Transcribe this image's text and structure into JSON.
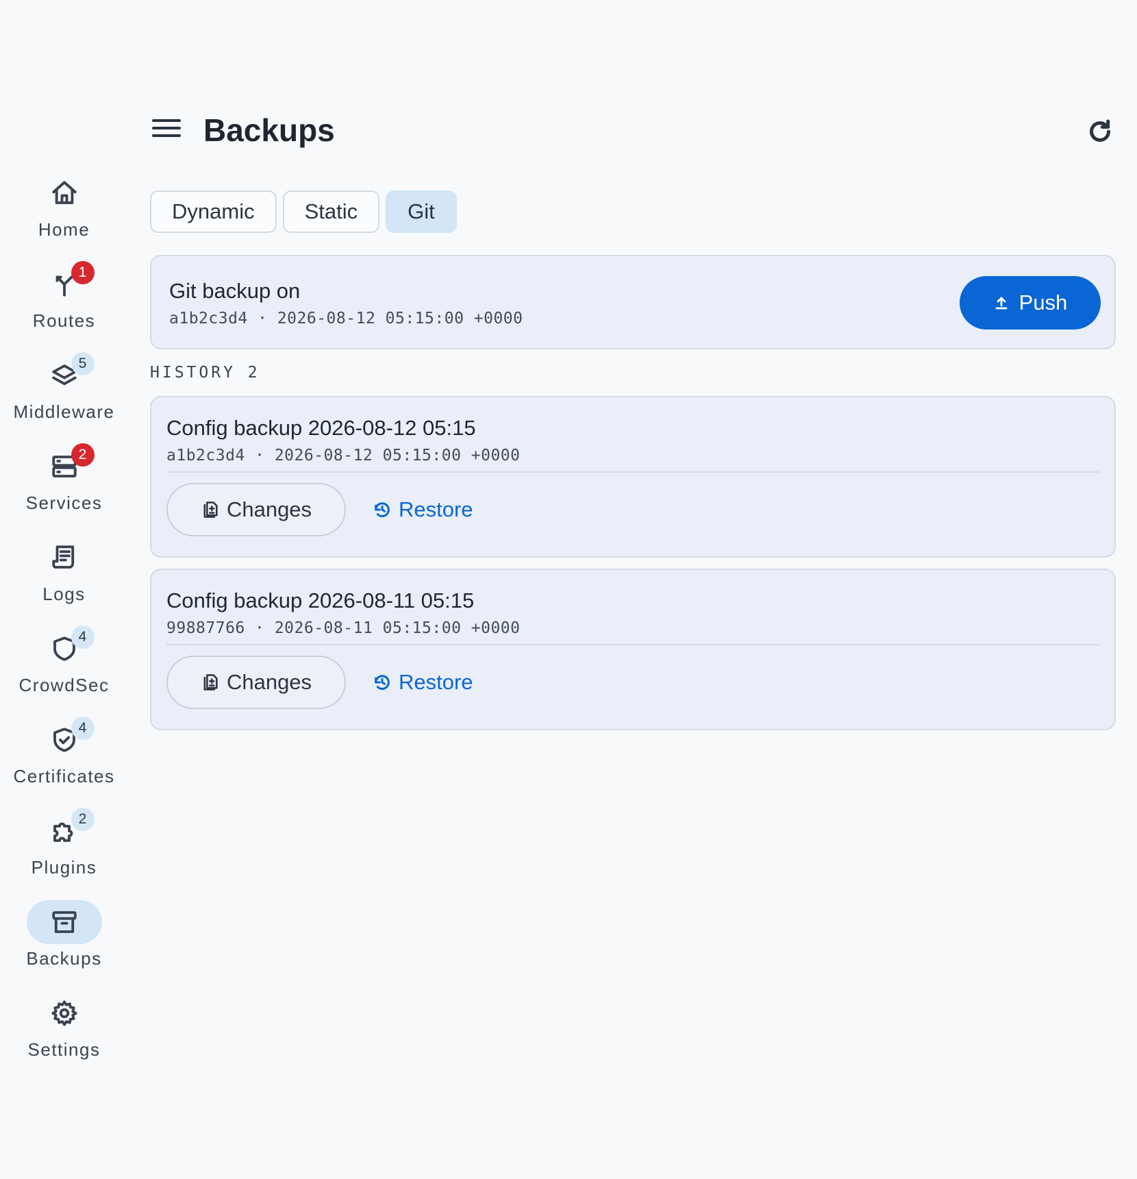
{
  "header": {
    "title": "Backups"
  },
  "sidebar": {
    "items": [
      {
        "label": "Home",
        "icon": "home-icon",
        "badge": ""
      },
      {
        "label": "Routes",
        "icon": "routes-icon",
        "badge": "1"
      },
      {
        "label": "Middleware",
        "icon": "layers-icon",
        "badge": "5"
      },
      {
        "label": "Services",
        "icon": "server-icon",
        "badge": "2"
      },
      {
        "label": "Logs",
        "icon": "receipt-icon",
        "badge": ""
      },
      {
        "label": "CrowdSec",
        "icon": "shield-icon",
        "badge": "4"
      },
      {
        "label": "Certificates",
        "icon": "shield-check-icon",
        "badge": "4"
      },
      {
        "label": "Plugins",
        "icon": "puzzle-icon",
        "badge": "2"
      },
      {
        "label": "Backups",
        "icon": "archive-icon",
        "badge": "",
        "active": true
      },
      {
        "label": "Settings",
        "icon": "gear-icon",
        "badge": ""
      }
    ]
  },
  "tabs": [
    {
      "label": "Dynamic"
    },
    {
      "label": "Static"
    },
    {
      "label": "Git",
      "active": true
    }
  ],
  "git_status": {
    "title": "Git backup on",
    "meta": "a1b2c3d4 · 2026-08-12 05:15:00 +0000",
    "push_label": "Push"
  },
  "history": {
    "heading": "HISTORY 2",
    "entries": [
      {
        "title": "Config backup 2026-08-12 05:15",
        "meta": "a1b2c3d4 · 2026-08-12 05:15:00 +0000",
        "changes_label": "Changes",
        "restore_label": "Restore"
      },
      {
        "title": "Config backup 2026-08-11 05:15",
        "meta": "99887766 · 2026-08-11 05:15:00 +0000",
        "changes_label": "Changes",
        "restore_label": "Restore"
      }
    ]
  },
  "colors": {
    "accent": "#0a66d4",
    "badge_red": "#d7282f",
    "active_tab": "#d3e5f6",
    "card_bg": "#e9eef8"
  }
}
